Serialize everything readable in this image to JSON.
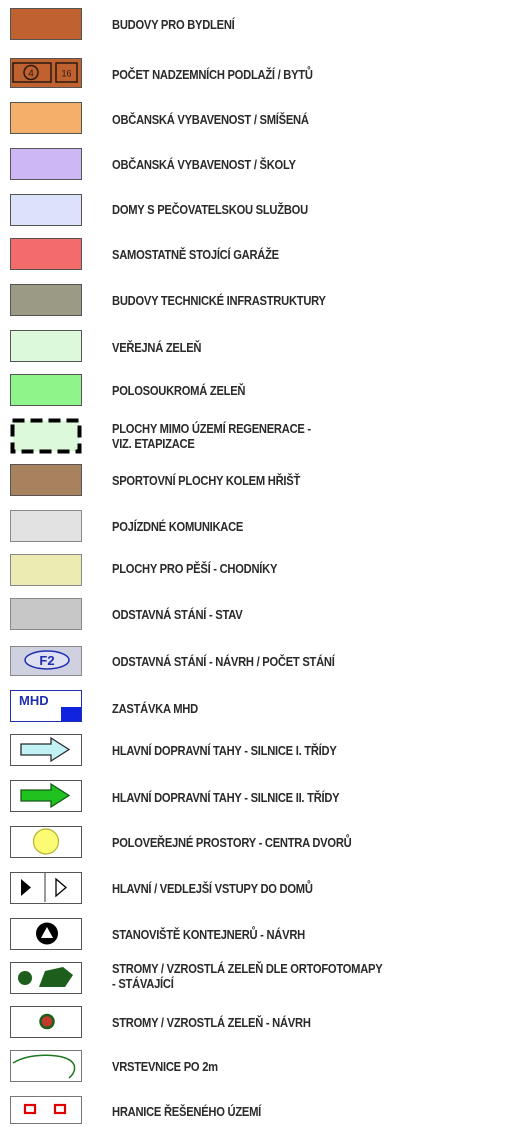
{
  "legend": {
    "items": [
      {
        "label": "BUDOVY PRO BYDLENÍ",
        "color": "#c0622f"
      },
      {
        "label": "POČET NADZEMNÍCH PODLAŽÍ / BYTŮ",
        "color": "#c0622f",
        "floors": "4",
        "flats": "16"
      },
      {
        "label": "OBČANSKÁ VYBAVENOST / SMÍŠENÁ",
        "color": "#f4b06a"
      },
      {
        "label": "OBČANSKÁ VYBAVENOST / ŠKOLY",
        "color": "#cdb8f5"
      },
      {
        "label": "DOMY S PEČOVATELSKOU SLUŽBOU",
        "color": "#dde2fb"
      },
      {
        "label": "SAMOSTATNĚ STOJÍCÍ GARÁŽE",
        "color": "#f36b6b"
      },
      {
        "label": "BUDOVY TECHNICKÉ INFRASTRUKTURY",
        "color": "#9a9a85"
      },
      {
        "label": "VEŘEJNÁ ZELEŇ",
        "color": "#dcfadb"
      },
      {
        "label": "POLOSOUKROMÁ ZELEŇ",
        "color": "#8ff58a"
      },
      {
        "label_line1": "PLOCHY MIMO ÚZEMÍ REGENERACE -",
        "label_line2": "VIZ. ETAPIZACE",
        "color": "#dcfadb"
      },
      {
        "label": "SPORTOVNÍ PLOCHY KOLEM HŘIŠŤ",
        "color": "#a8825e"
      },
      {
        "label": "POJÍZDNÉ KOMUNIKACE",
        "color": "#e2e2e2"
      },
      {
        "label": "PLOCHY PRO PĚŠÍ - CHODNÍKY",
        "color": "#ecebb1"
      },
      {
        "label": "ODSTAVNÁ STÁNÍ - STAV",
        "color": "#c7c7c7"
      },
      {
        "label": "ODSTAVNÁ STÁNÍ - NÁVRH / POČET STÁNÍ",
        "color": "#cfd0e0",
        "badge": "F2"
      },
      {
        "label": "ZASTÁVKA MHD",
        "sign": "MHD"
      },
      {
        "label": "HLAVNÍ DOPRAVNÍ TAHY - SILNICE I. TŘÍDY",
        "color": "#c3f2f6"
      },
      {
        "label": "HLAVNÍ DOPRAVNÍ TAHY - SILNICE II. TŘÍDY",
        "color": "#1fc21f"
      },
      {
        "label": "POLOVEŘEJNÉ PROSTORY - CENTRA DVORŮ",
        "color": "#fdfb74"
      },
      {
        "label": "HLAVNÍ / VEDLEJŠÍ VSTUPY DO DOMŮ"
      },
      {
        "label": "STANOVIŠTĚ KONTEJNERŮ - NÁVRH"
      },
      {
        "label_line1": "STROMY / VZROSTLÁ ZELEŇ DLE ORTOFOTOMAPY",
        "label_line2": "- STÁVAJÍCÍ",
        "color": "#1d5e1d"
      },
      {
        "label": "STROMY / VZROSTLÁ ZELEŇ - NÁVRH",
        "color": "#c0392b"
      },
      {
        "label": "VRSTEVNICE PO 2m",
        "color": "#1e7a1e"
      },
      {
        "label": "HRANICE ŘEŠENÉHO ÚZEMÍ",
        "color": "#e00000"
      }
    ]
  }
}
